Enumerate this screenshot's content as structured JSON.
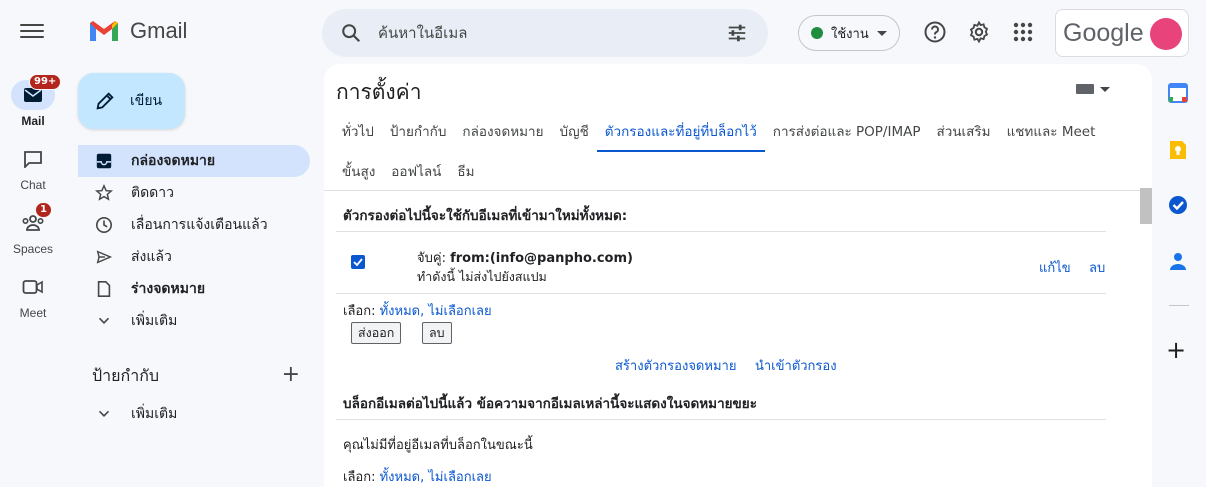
{
  "header": {
    "app_name": "Gmail",
    "search_placeholder": "ค้นหาในอีเมล",
    "status_label": "ใช้งาน",
    "account_logo": "Google"
  },
  "rail": {
    "mail": {
      "label": "Mail",
      "badge": "99+"
    },
    "chat": {
      "label": "Chat"
    },
    "spaces": {
      "label": "Spaces",
      "badge": "1"
    },
    "meet": {
      "label": "Meet"
    }
  },
  "compose": {
    "label": "เขียน"
  },
  "nav": {
    "items": [
      {
        "label": "กล่องจดหมาย",
        "icon": "inbox-icon"
      },
      {
        "label": "ติดดาว",
        "icon": "star-icon"
      },
      {
        "label": "เลื่อนการแจ้งเตือนแล้ว",
        "icon": "clock-icon"
      },
      {
        "label": "ส่งแล้ว",
        "icon": "send-icon"
      },
      {
        "label": "ร่างจดหมาย",
        "icon": "draft-icon"
      },
      {
        "label": "เพิ่มเติม",
        "icon": "chevron-down-icon"
      }
    ],
    "labels_title": "ป้ายกำกับ",
    "labels_more": "เพิ่มเติม"
  },
  "settings": {
    "title": "การตั้งค่า",
    "tabs_row1": [
      "ทั่วไป",
      "ป้ายกำกับ",
      "กล่องจดหมาย",
      "บัญชี",
      "ตัวกรองและที่อยู่ที่บล็อกไว้",
      "การส่งต่อและ POP/IMAP",
      "ส่วนเสริม",
      "แชทและ Meet"
    ],
    "tabs_row2": [
      "ขั้นสูง",
      "ออฟไลน์",
      "ธีม"
    ],
    "active_tab": "ตัวกรองและที่อยู่ที่บล็อกไว้"
  },
  "filters": {
    "section_title": "ตัวกรองต่อไปนี้จะใช้กับอีเมลที่เข้ามาใหม่ทั้งหมด:",
    "rows": [
      {
        "match_prefix": "จับคู่: ",
        "match_value": "from:(info@panpho.com)",
        "action": "ทำดังนี้ ไม่ส่งไปยังสแปม",
        "edit": "แก้ไข",
        "delete": "ลบ",
        "checked": true
      }
    ],
    "select_label": "เลือก:",
    "select_all": "ทั้งหมด",
    "select_sep": ",",
    "select_none": "ไม่เลือกเลย",
    "export_btn": "ส่งออก",
    "delete_btn": "ลบ",
    "create_filter": "สร้างตัวกรองจดหมาย",
    "import_filter": "นำเข้าตัวกรอง"
  },
  "blocked": {
    "section_title": "บล็อกอีเมลต่อไปนี้แล้ว ข้อความจากอีเมลเหล่านี้จะแสดงในจดหมายขยะ",
    "empty_text": "คุณไม่มีที่อยู่อีเมลที่บล็อกในขณะนี้",
    "select_label": "เลือก:",
    "select_all": "ทั้งหมด",
    "select_sep": ",",
    "select_none": "ไม่เลือกเลย"
  },
  "colors": {
    "accent": "#0b57d0",
    "compose_bg": "#c2e7ff",
    "active_nav": "#d3e3fd",
    "status_dot": "#1e8e3e",
    "badge": "#b3261e",
    "avatar": "#e8437a"
  }
}
